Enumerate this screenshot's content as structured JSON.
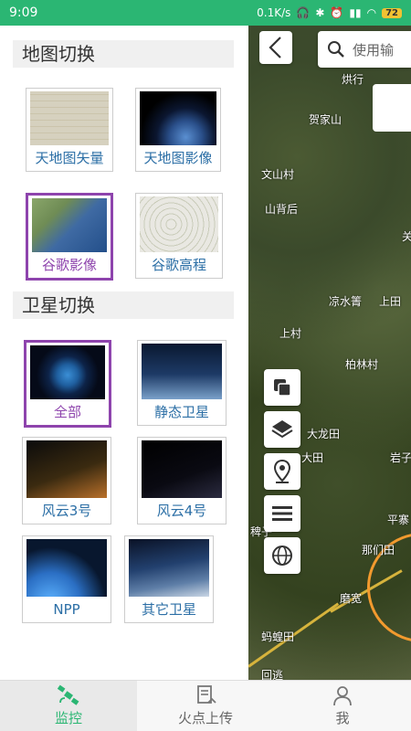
{
  "status": {
    "time": "9:09",
    "speed": "0.1K/s",
    "battery": "72"
  },
  "map": {
    "search_placeholder": "使用输",
    "places": [
      "烘行",
      "贺家山",
      "文山村",
      "山背后",
      "凉水箐",
      "上田",
      "上村",
      "柏林村",
      "大龙田",
      "大田",
      "岩子",
      "稗子",
      "平寨",
      "那们田",
      "磨宽",
      "蚂蝗田",
      "回逃",
      "关"
    ]
  },
  "panel": {
    "map_section_title": "地图切换",
    "map_options": [
      {
        "label": "天地图矢量",
        "selected": false
      },
      {
        "label": "天地图影像",
        "selected": false
      },
      {
        "label": "谷歌影像",
        "selected": true
      },
      {
        "label": "谷歌高程",
        "selected": false
      }
    ],
    "sat_section_title": "卫星切换",
    "sat_options": [
      {
        "label": "全部",
        "selected": true
      },
      {
        "label": "静态卫星",
        "selected": false
      },
      {
        "label": "风云3号",
        "selected": false
      },
      {
        "label": "风云4号",
        "selected": false
      },
      {
        "label": "NPP",
        "selected": false
      },
      {
        "label": "其它卫星",
        "selected": false
      }
    ]
  },
  "nav": {
    "items": [
      {
        "label": "监控",
        "icon": "satellite-icon",
        "active": true
      },
      {
        "label": "火点上传",
        "icon": "upload-document-icon",
        "active": false
      },
      {
        "label": "我",
        "icon": "person-icon",
        "active": false
      }
    ]
  },
  "colors": {
    "accent": "#2bb673",
    "selected": "#8e44ad",
    "label": "#2c6fa6"
  }
}
